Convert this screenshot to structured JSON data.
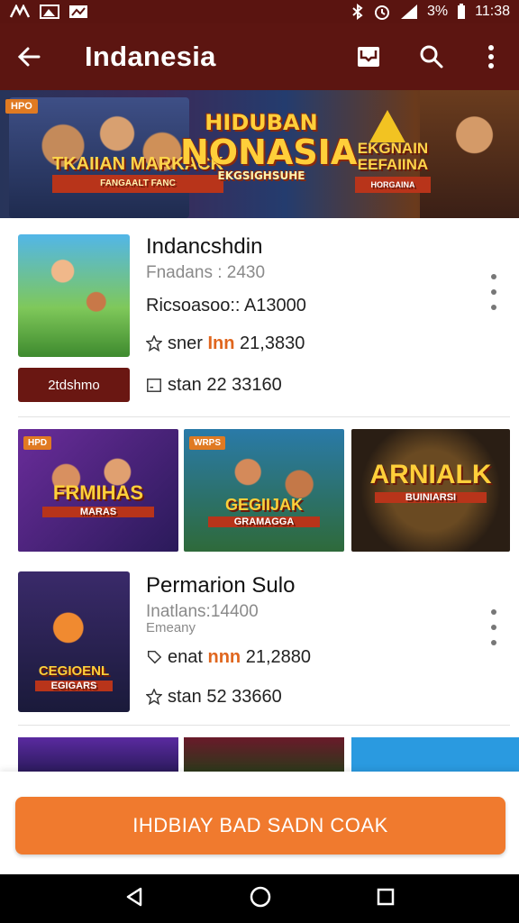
{
  "status_bar": {
    "battery": "3%",
    "time": "11:38"
  },
  "app_bar": {
    "title": "Indanesia"
  },
  "banner": {
    "left_tag": "HPO",
    "left_text": "TKAIIAN MARKACK",
    "left_sub": "FANGAALT FANC",
    "center_line1": "HIDUBAN",
    "center_line2": "NONASIA",
    "center_line3": "EKGSIGHSUHE",
    "right_line1": "EKGNAIN",
    "right_line2": "EEFAIINA",
    "right_sub": "HORGAINA"
  },
  "item1": {
    "title": "Indancshdin",
    "line1": "Fnadans : 2430",
    "line2": "Ricsoasoo:: A13000",
    "line3_label": "sner",
    "line3_hl": "Inn",
    "line3_value": "21,3830",
    "line4_label": "stan",
    "line4_value": "22 33160",
    "button": "2tdshmo"
  },
  "grid": [
    {
      "tag": "HPD",
      "text": "FRMIHAS",
      "sub": "MARAS"
    },
    {
      "tag": "WRPS",
      "text": "GEGIIJAK",
      "sub": "GRAMAGGA"
    },
    {
      "tag": "",
      "text": "ARNIALK",
      "sub": "BUINIARSI"
    }
  ],
  "item2": {
    "title": "Permarion Sulo",
    "line1": "Inatlans:14400",
    "line2": "Emeany",
    "line3_label": "enat",
    "line3_hl": "nnn",
    "line3_value": "21,2880",
    "line4_label": "stan",
    "line4_value": "52 33660",
    "thumb_text": "CEGIOENL",
    "thumb_sub": "EGIGARS"
  },
  "cta": {
    "label": "IHDBIAY BAD SADN COAK"
  },
  "colors": {
    "app_bar": "#5c1511",
    "accent": "#f07a2e",
    "dark_button": "#6a1712",
    "highlight": "#e0661e"
  }
}
